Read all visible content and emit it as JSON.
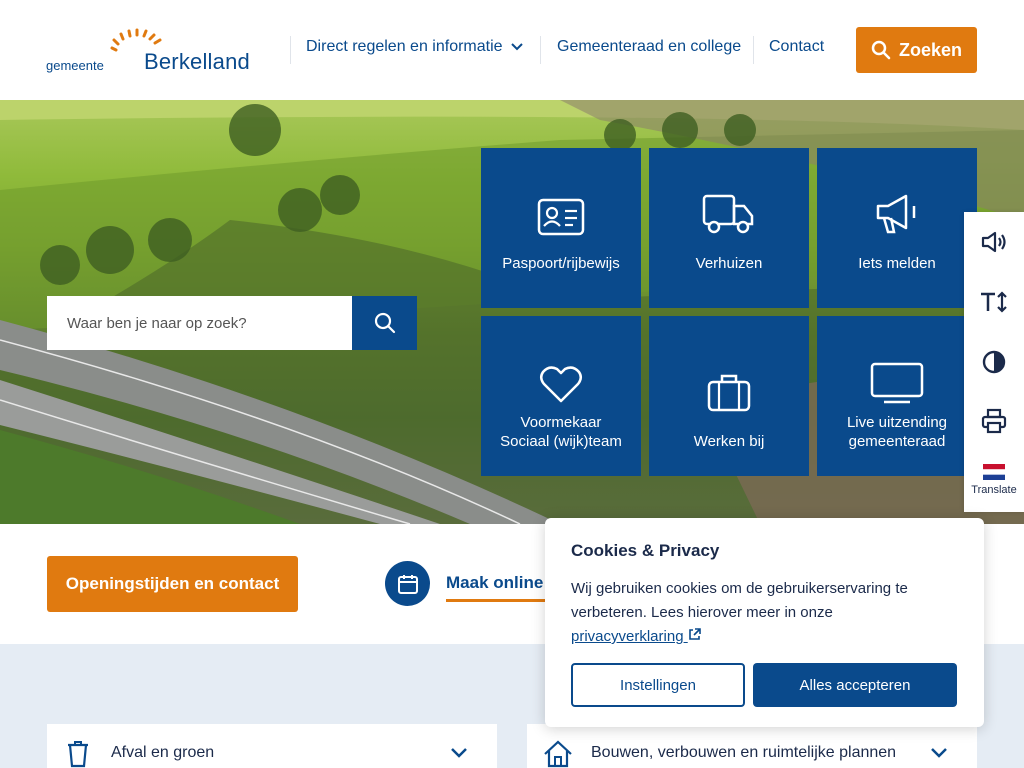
{
  "logo": {
    "small": "gemeente",
    "big": "Berkelland"
  },
  "nav": {
    "items": [
      {
        "label": "Direct regelen en informatie"
      },
      {
        "label": "Gemeenteraad en college"
      },
      {
        "label": "Contact"
      }
    ],
    "search_label": "Zoeken"
  },
  "hero": {
    "search_placeholder": "Waar ben je naar op zoek?",
    "tiles": [
      {
        "label": "Paspoort/rijbewijs",
        "icon": "id-card-icon"
      },
      {
        "label": "Verhuizen",
        "icon": "truck-icon"
      },
      {
        "label": "Iets melden",
        "icon": "megaphone-icon"
      },
      {
        "label": "Voormekaar",
        "label2": "Sociaal (wijk)team",
        "icon": "heart-icon"
      },
      {
        "label": "Werken bij",
        "icon": "briefcase-icon"
      },
      {
        "label": "Live uitzending",
        "label2": "gemeenteraad",
        "icon": "monitor-icon"
      }
    ]
  },
  "sidebar": {
    "items": [
      {
        "icon": "speaker-icon"
      },
      {
        "icon": "text-size-icon"
      },
      {
        "icon": "contrast-icon"
      },
      {
        "icon": "printer-icon"
      },
      {
        "icon": "dutch-flag-icon",
        "label": "Translate"
      }
    ]
  },
  "quick": {
    "hours_label": "Openingstijden en contact",
    "make_label": "Maak online"
  },
  "accordion": [
    {
      "label": "Afval en groen",
      "icon": "trash-icon"
    },
    {
      "label": "Bouwen, verbouwen en ruimtelijke plannen",
      "icon": "house-icon"
    }
  ],
  "cookie": {
    "title": "Cookies & Privacy",
    "text": "Wij gebruiken cookies om de gebruikerservaring te verbeteren. Lees hierover meer in onze",
    "link": "privacyverklaring",
    "settings_label": "Instellingen",
    "accept_label": "Alles accepteren"
  },
  "colors": {
    "primary": "#0a4a8c",
    "accent": "#e07a10",
    "lower_bg": "#e5ecf4"
  }
}
